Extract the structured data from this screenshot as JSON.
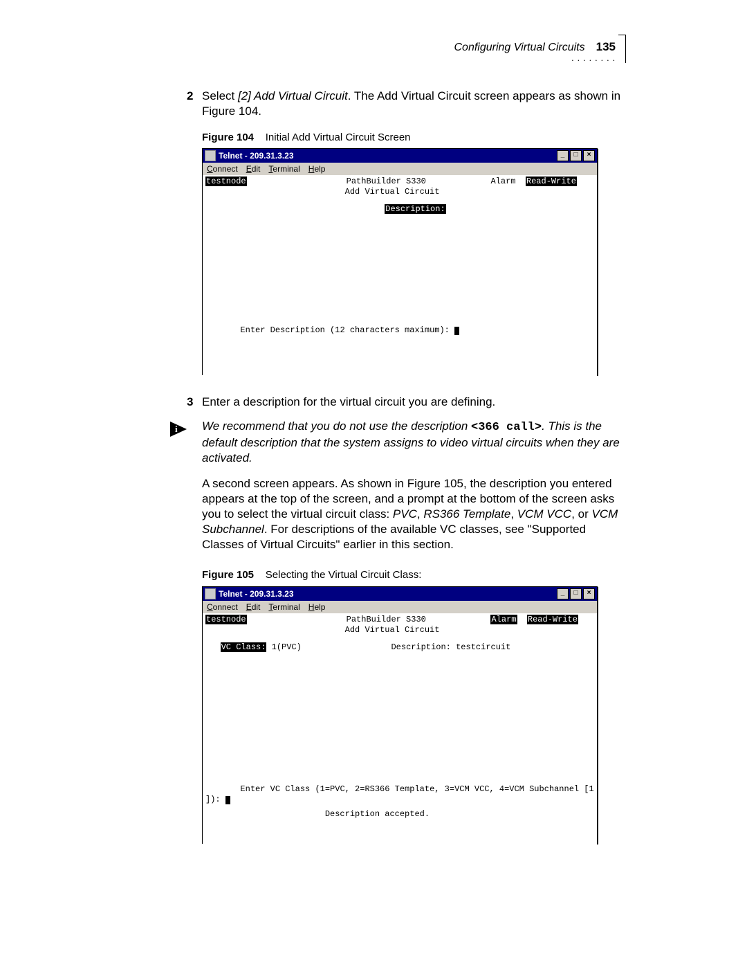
{
  "header": {
    "section_title": "Configuring Virtual Circuits",
    "page_number": "135",
    "dots": ". . . . . . . ."
  },
  "step2": {
    "number": "2",
    "text_a": "Select ",
    "text_b": "[2] Add Virtual Circuit",
    "text_c": ". The Add Virtual Circuit screen appears as shown in Figure 104."
  },
  "fig104": {
    "label": "Figure 104",
    "caption": "Initial Add Virtual Circuit Screen"
  },
  "telnet1": {
    "title": "Telnet - 209.31.3.23",
    "menu": {
      "connect": "Connect",
      "edit": "Edit",
      "terminal": "Terminal",
      "help": "Help"
    },
    "hostname": "testnode",
    "header1": "PathBuilder S330",
    "header2": "Add Virtual Circuit",
    "alarm": "Alarm",
    "mode": "Read-Write",
    "desc_label": "Description:",
    "prompt": "Enter Description (12 characters maximum): "
  },
  "step3": {
    "number": "3",
    "text": "Enter a description for the virtual circuit you are defining."
  },
  "note": {
    "pre": "We recommend that you do not use the description ",
    "code": "<366 call>",
    "post": ". This is the default description that the system assigns to video virtual circuits when they are activated."
  },
  "para2": {
    "t1": "A second screen appears. As shown in Figure 105, the description you entered appears at the top of the screen, and a prompt at the bottom of the screen asks you to select the virtual circuit class: ",
    "pvc": "PVC",
    "c1": ", ",
    "rs": "RS366 Template",
    "c2": ", ",
    "vcc": "VCM VCC",
    "c3": ", or ",
    "sub": "VCM Subchannel",
    "t2": ". For descriptions of the available VC classes, see \"Supported Classes of Virtual Circuits\" earlier in this section."
  },
  "fig105": {
    "label": "Figure 105",
    "caption": "Selecting the Virtual Circuit Class:"
  },
  "telnet2": {
    "title": "Telnet - 209.31.3.23",
    "menu": {
      "connect": "Connect",
      "edit": "Edit",
      "terminal": "Terminal",
      "help": "Help"
    },
    "hostname": "testnode",
    "header1": "PathBuilder S330",
    "header2": "Add Virtual Circuit",
    "alarm": "Alarm",
    "mode": "Read-Write",
    "vc_class_label": "VC Class:",
    "vc_class_value": "1(PVC)",
    "desc_label": "Description:",
    "desc_value": "testcircuit",
    "prompt": "Enter VC Class (1=PVC, 2=RS366 Template, 3=VCM VCC, 4=VCM Subchannel [1",
    "prompt2": "]): ",
    "status": "Description accepted."
  }
}
